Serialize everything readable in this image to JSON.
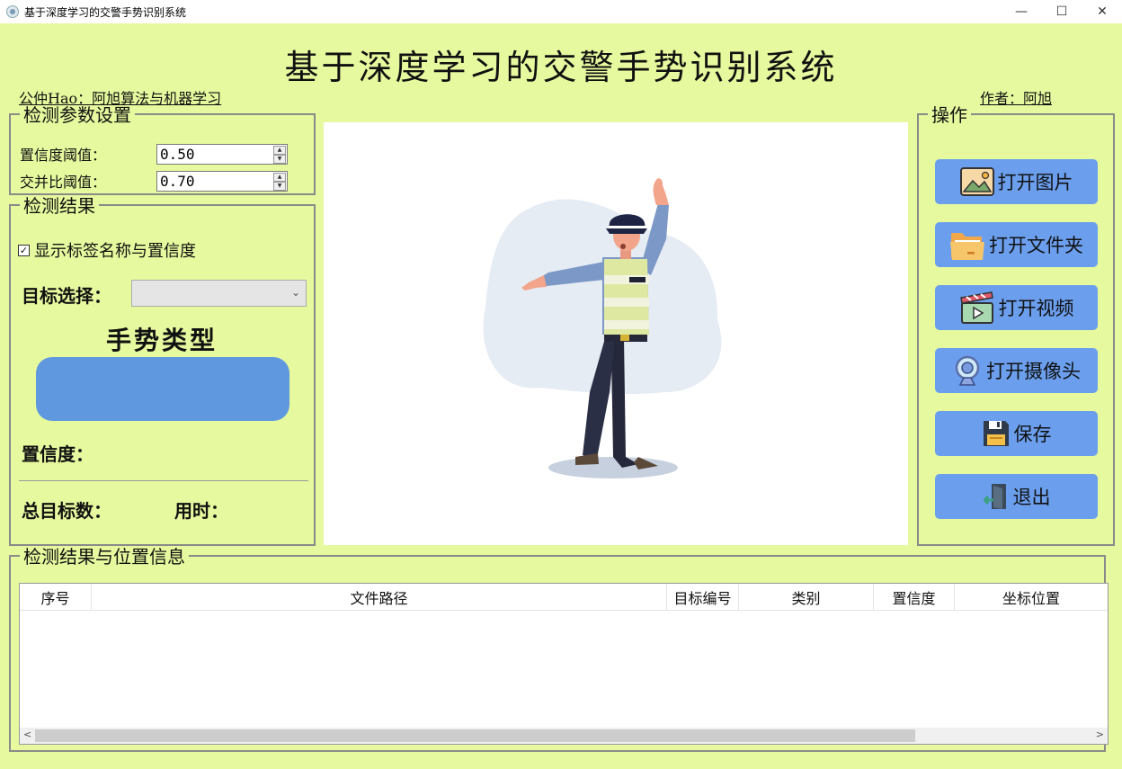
{
  "window": {
    "title": "基于深度学习的交警手势识别系统",
    "controls": {
      "minimize": "—",
      "maximize": "☐",
      "close": "✕"
    }
  },
  "header": {
    "title": "基于深度学习的交警手势识别系统",
    "subtitle_left": "公仲Hao：阿旭算法与机器学习",
    "subtitle_right": "作者：阿旭"
  },
  "params": {
    "title": "检测参数设置",
    "confidence_label": "置信度阈值：",
    "confidence_value": "0.50",
    "iou_label": "交并比阈值：",
    "iou_value": "0.70"
  },
  "results": {
    "title": "检测结果",
    "show_labels": "显示标签名称与置信度",
    "show_labels_checked": true,
    "target_select_label": "目标选择：",
    "target_select_value": "",
    "gesture_title": "手势类型",
    "gesture_value": "",
    "confidence_label": "置信度：",
    "total_label": "总目标数：",
    "time_label": "用时："
  },
  "operations": {
    "title": "操作",
    "buttons": [
      {
        "label": "打开图片",
        "icon": "image-icon"
      },
      {
        "label": "打开文件夹",
        "icon": "folder-icon"
      },
      {
        "label": "打开视频",
        "icon": "video-icon"
      },
      {
        "label": "打开摄像头",
        "icon": "camera-icon"
      },
      {
        "label": "保存",
        "icon": "floppy-icon"
      },
      {
        "label": "退出",
        "icon": "exit-icon"
      }
    ]
  },
  "table": {
    "title": "检测结果与位置信息",
    "columns": [
      "序号",
      "文件路径",
      "目标编号",
      "类别",
      "置信度",
      "坐标位置"
    ],
    "rows": []
  },
  "colors": {
    "background": "#e6f99e",
    "button": "#6b9fee",
    "gesture_box": "#6098e0"
  }
}
